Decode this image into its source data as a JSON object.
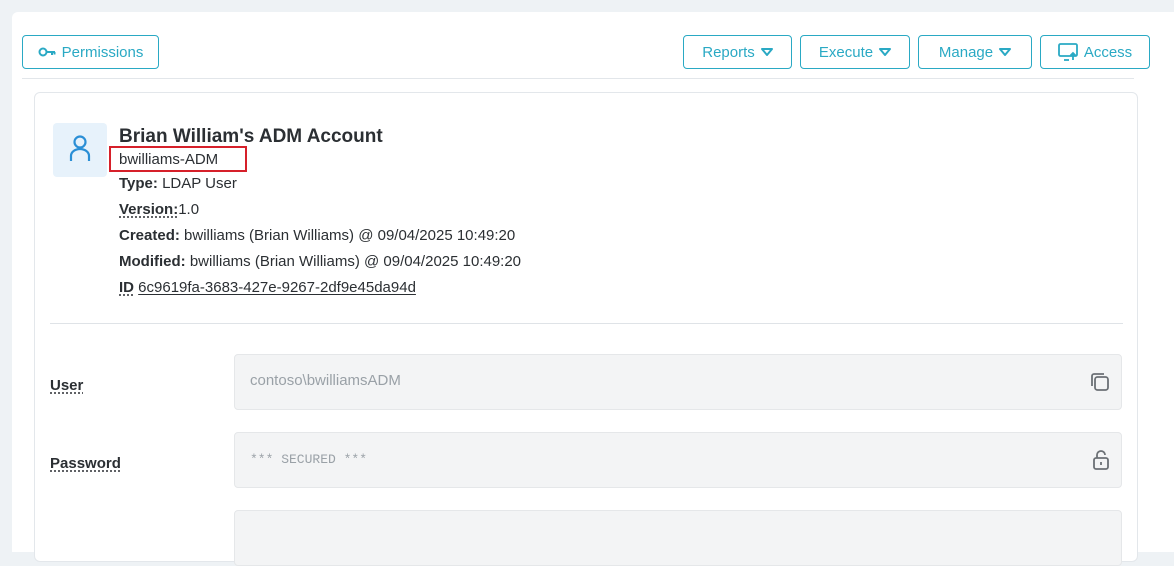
{
  "toolbar": {
    "permissions_label": "Permissions",
    "reports_label": "Reports",
    "execute_label": "Execute",
    "manage_label": "Manage",
    "access_label": "Access"
  },
  "account": {
    "title": "Brian William's ADM Account",
    "username": "bwilliams-ADM",
    "type_label": "Type:",
    "type_value": "LDAP User",
    "version_label": "Version:",
    "version_value": "1.0",
    "created_label": "Created:",
    "created_value": "bwilliams (Brian Williams) @ 09/04/2025 10:49:20",
    "modified_label": "Modified:",
    "modified_value": "bwilliams (Brian Williams) @ 09/04/2025 10:49:20",
    "id_label": "ID",
    "id_value": "6c9619fa-3683-427e-9267-2df9e45da94d"
  },
  "fields": {
    "user_label": "User",
    "user_value": "contoso\\bwilliamsADM",
    "password_label": "Password",
    "password_value": "*** SECURED ***"
  },
  "colors": {
    "accent": "#2aa9c4",
    "highlight_border": "#d6202a",
    "avatar_bg": "#e7f2fb"
  },
  "icons": [
    "key-icon",
    "caret-down-icon",
    "monitor-upload-icon",
    "user-icon",
    "copy-icon",
    "unlock-icon"
  ]
}
